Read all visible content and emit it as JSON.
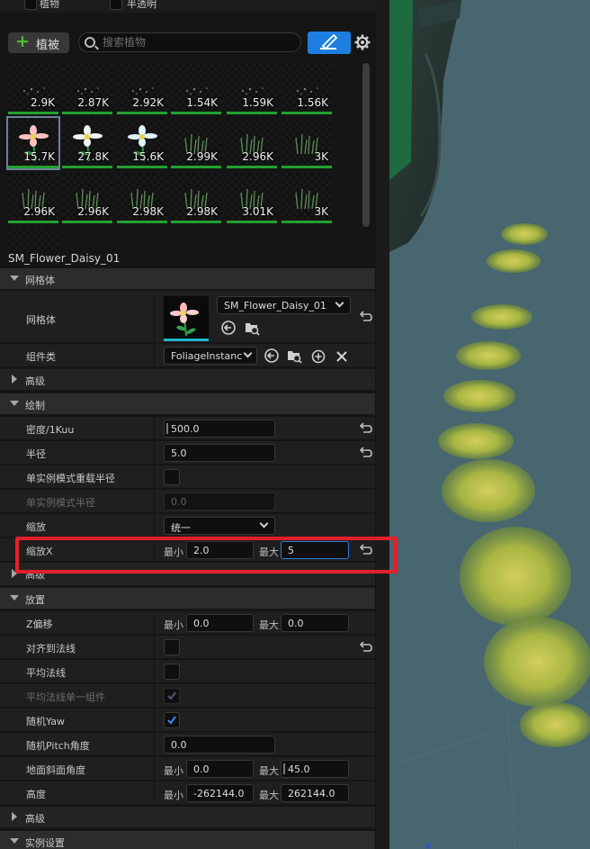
{
  "filters": {
    "foliage_label": "植物",
    "translucent_label": "半透明"
  },
  "toolbar": {
    "add_label": "植被",
    "search_placeholder": "搜索植物"
  },
  "thumbnails": [
    {
      "count": "2.9K"
    },
    {
      "count": "2.87K"
    },
    {
      "count": "2.92K"
    },
    {
      "count": "1.54K"
    },
    {
      "count": "1.59K"
    },
    {
      "count": "1.56K"
    },
    {
      "count": "15.7K"
    },
    {
      "count": "27.8K"
    },
    {
      "count": "15.6K"
    },
    {
      "count": "2.99K"
    },
    {
      "count": "2.96K"
    },
    {
      "count": "3K"
    },
    {
      "count": "2.96K"
    },
    {
      "count": "2.96K"
    },
    {
      "count": "2.98K"
    },
    {
      "count": "2.98K"
    },
    {
      "count": "3.01K"
    },
    {
      "count": "3K"
    }
  ],
  "asset_name": "SM_Flower_Daisy_01",
  "sections": {
    "mesh": "网格体",
    "advanced": "高级",
    "paint": "绘制",
    "placement": "放置",
    "instance_settings": "实例设置"
  },
  "mesh": {
    "label": "网格体",
    "value": "SM_Flower_Daisy_01",
    "component_label": "组件类",
    "component_value": "FoliageInstanc"
  },
  "paint": {
    "density_label": "密度/1Kuu",
    "density_value": "500.0",
    "radius_label": "半径",
    "radius_value": "5.0",
    "single_override_label": "单实例模式重载半径",
    "single_radius_label": "单实例模式半径",
    "single_radius_value": "0.0",
    "scaling_label": "缩放",
    "scaling_value": "统一",
    "scale_x_label": "缩放X",
    "min_label": "最小",
    "max_label": "最大",
    "scale_x_min": "2.0",
    "scale_x_max": "5",
    "advanced_label": "高级"
  },
  "placement": {
    "z_offset_label": "Z偏移",
    "z_min": "0.0",
    "z_max": "0.0",
    "align_normal_label": "对齐到法线",
    "avg_normal_label": "平均法线",
    "avg_normal_single_label": "平均法线单一组件",
    "random_yaw_label": "随机Yaw",
    "random_pitch_label": "随机Pitch角度",
    "random_pitch_value": "0.0",
    "ground_slope_label": "地面斜面角度",
    "slope_min": "0.0",
    "slope_max": "45.0",
    "height_label": "高度",
    "height_min": "-262144.0",
    "height_max": "262144.0",
    "min_label": "最小",
    "max_label": "最大"
  },
  "colors": {
    "accent": "#1e7ee0",
    "highlight": "#e3202a",
    "green_bar": "#23a12f"
  }
}
